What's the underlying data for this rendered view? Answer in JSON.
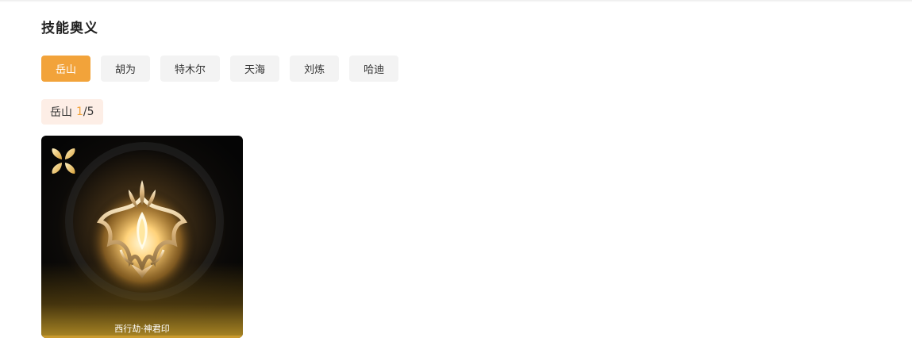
{
  "section": {
    "title": "技能奥义"
  },
  "tabs": [
    {
      "label": "岳山",
      "active": true
    },
    {
      "label": "胡为",
      "active": false
    },
    {
      "label": "特木尔",
      "active": false
    },
    {
      "label": "天海",
      "active": false
    },
    {
      "label": "刘炼",
      "active": false
    },
    {
      "label": "哈迪",
      "active": false
    }
  ],
  "counter": {
    "name": "岳山",
    "current": "1",
    "separator": "/",
    "total": "5"
  },
  "card": {
    "name": "西行劫·神君印",
    "corner_icon": "four-petal-icon",
    "emblem_icon": "golden-crest-emblem"
  },
  "colors": {
    "accent": "#f2a33a",
    "tab_bg": "#f3f3f3",
    "counter_bg": "#fdeee6"
  }
}
